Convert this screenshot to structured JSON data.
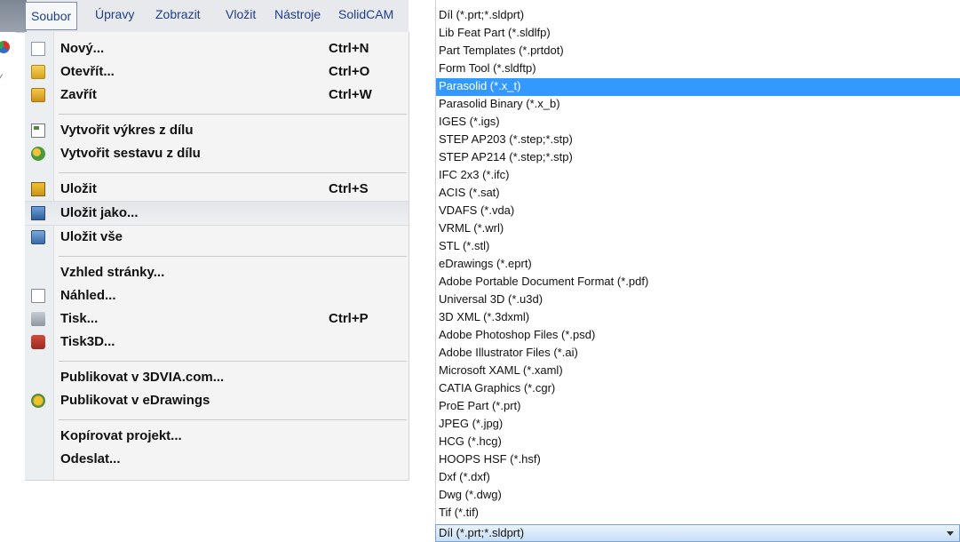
{
  "menubar": {
    "items": [
      "Soubor",
      "Úpravy",
      "Zobrazit",
      "Vložit",
      "Nástroje",
      "SolidCAM"
    ]
  },
  "file_menu": {
    "items": [
      {
        "label": "Nový...",
        "shortcut": "Ctrl+N",
        "icon": "new-document-icon"
      },
      {
        "label": "Otevřít...",
        "shortcut": "Ctrl+O",
        "icon": "open-folder-icon"
      },
      {
        "label": "Zavřít",
        "shortcut": "Ctrl+W",
        "icon": "close-folder-icon"
      },
      {
        "label": "Vytvořit výkres z dílu",
        "shortcut": "",
        "icon": "drawing-icon"
      },
      {
        "label": "Vytvořit sestavu z dílu",
        "shortcut": "",
        "icon": "assembly-icon"
      },
      {
        "label": "Uložit",
        "shortcut": "Ctrl+S",
        "icon": "save-icon"
      },
      {
        "label": "Uložit jako...",
        "shortcut": "",
        "icon": "save-as-icon"
      },
      {
        "label": "Uložit vše",
        "shortcut": "",
        "icon": "save-all-icon"
      },
      {
        "label": "Vzhled stránky...",
        "shortcut": "",
        "icon": ""
      },
      {
        "label": "Náhled...",
        "shortcut": "",
        "icon": "preview-icon"
      },
      {
        "label": "Tisk...",
        "shortcut": "Ctrl+P",
        "icon": "print-icon"
      },
      {
        "label": "Tisk3D...",
        "shortcut": "",
        "icon": "print3d-icon"
      },
      {
        "label": "Publikovat v 3DVIA.com...",
        "shortcut": "",
        "icon": ""
      },
      {
        "label": "Publikovat v eDrawings",
        "shortcut": "",
        "icon": "edrawings-icon"
      },
      {
        "label": "Kopírovat projekt...",
        "shortcut": "",
        "icon": ""
      },
      {
        "label": "Odeslat...",
        "shortcut": "",
        "icon": ""
      }
    ],
    "highlighted": "Uložit jako..."
  },
  "file_types": {
    "options": [
      "Díl (*.prt;*.sldprt)",
      "Lib Feat Part (*.sldlfp)",
      "Part Templates (*.prtdot)",
      "Form Tool (*.sldftp)",
      "Parasolid (*.x_t)",
      "Parasolid Binary (*.x_b)",
      "IGES (*.igs)",
      "STEP AP203 (*.step;*.stp)",
      "STEP AP214 (*.step;*.stp)",
      "IFC 2x3 (*.ifc)",
      "ACIS (*.sat)",
      "VDAFS (*.vda)",
      "VRML (*.wrl)",
      "STL (*.stl)",
      "eDrawings (*.eprt)",
      "Adobe Portable Document Format (*.pdf)",
      "Universal 3D (*.u3d)",
      "3D XML (*.3dxml)",
      "Adobe Photoshop Files (*.psd)",
      "Adobe Illustrator Files (*.ai)",
      "Microsoft XAML (*.xaml)",
      "CATIA Graphics (*.cgr)",
      "ProE Part (*.prt)",
      "JPEG (*.jpg)",
      "HCG (*.hcg)",
      "HOOPS HSF (*.hsf)",
      "Dxf (*.dxf)",
      "Dwg (*.dwg)",
      "Tif (*.tif)"
    ],
    "selected": "Parasolid (*.x_t)",
    "combo_value": "Díl (*.prt;*.sldprt)"
  },
  "colors": {
    "selection": "#3399ff",
    "menu_bg": "#f4f4f4",
    "combo_bg": "#c7def6"
  }
}
